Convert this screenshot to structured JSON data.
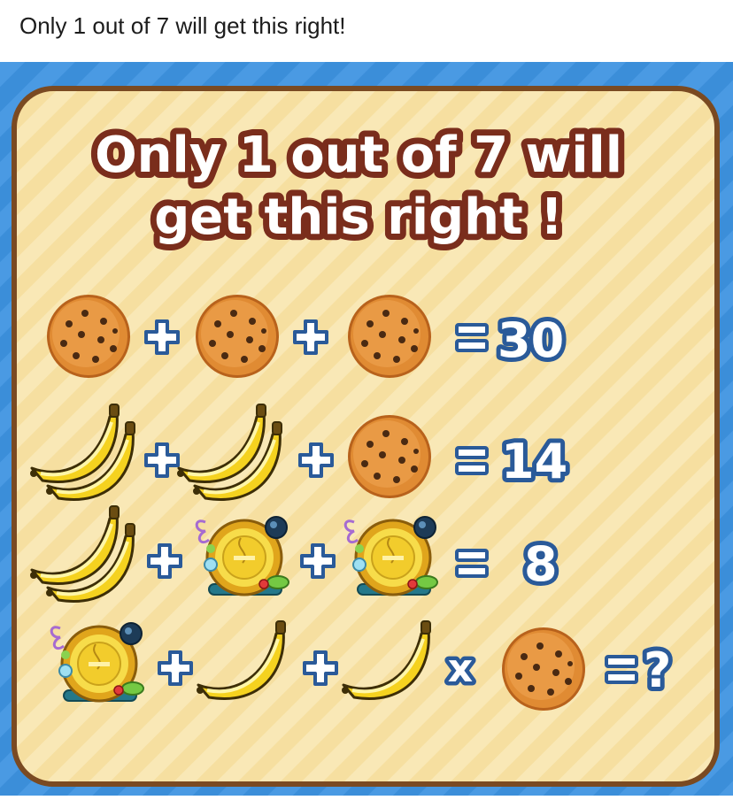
{
  "post": {
    "caption": "Only 1 out of 7 will get this right!"
  },
  "puzzle": {
    "title_line1": "Only 1 out of 7 will",
    "title_line2": "get this right !",
    "plus_symbol": "+",
    "equals_symbol": "=",
    "times_symbol": "x",
    "equations": [
      {
        "terms": [
          "cookie",
          "cookie",
          "cookie"
        ],
        "ops": [
          "+",
          "+"
        ],
        "result": "30"
      },
      {
        "terms": [
          "bananas-double",
          "bananas-double",
          "cookie"
        ],
        "ops": [
          "+",
          "+"
        ],
        "result": "14"
      },
      {
        "terms": [
          "bananas-double",
          "clock",
          "clock"
        ],
        "ops": [
          "+",
          "+"
        ],
        "result": "8"
      },
      {
        "terms": [
          "clock",
          "banana-single",
          "banana-single",
          "cookie"
        ],
        "ops": [
          "+",
          "+",
          "x"
        ],
        "result": "?"
      }
    ],
    "icons": {
      "cookie": "cookie-icon",
      "bananas-double": "bananas-icon",
      "banana-single": "banana-icon",
      "clock": "clock-icon"
    },
    "colors": {
      "background_blue": "#3b8ed9",
      "board_fill": "#f7e2a3",
      "board_border": "#7a4a22",
      "symbol_fill": "#ffffff",
      "symbol_outline": "#2a5a99",
      "title_outline": "#7a2d1c",
      "cookie": "#d9822b",
      "banana": "#f5d21f",
      "clock": "#f2cc2c"
    }
  }
}
